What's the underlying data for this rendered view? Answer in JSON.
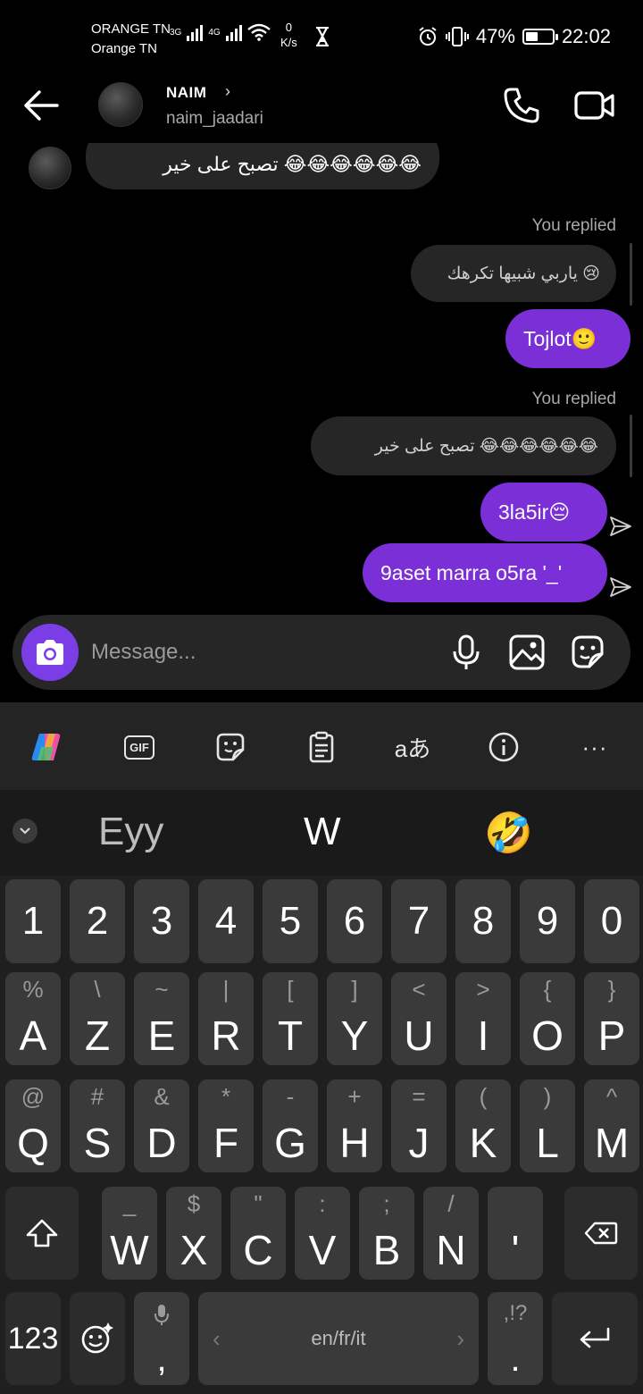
{
  "status_bar": {
    "carrier_line1": "ORANGE TN",
    "carrier_line2": "Orange TN",
    "network1": "3G",
    "network2": "4G",
    "speed_value": "0",
    "speed_unit": "K/s",
    "battery": "47%",
    "battery_level": 0.47,
    "time": "22:02"
  },
  "header": {
    "name": "NAIM",
    "username": "naim_jaadari"
  },
  "messages": {
    "incoming_1": "تصبح على خير 😂😂😂😂😂😂",
    "replied_label_1": "You replied",
    "quoted_1": "ياربي شبيها تكرهك 😢",
    "reply_1": "Tojlot🙂",
    "replied_label_2": "You replied",
    "quoted_2": "تصبح على خير 😂😂😂😂😂😂",
    "out_1": "3la5ir😔",
    "out_2": "9aset marra o5ra '_'"
  },
  "composer": {
    "placeholder": "Message..."
  },
  "keyboard": {
    "toolbar": [
      "copilot-icon",
      "gif-icon",
      "sticker-icon",
      "clipboard-icon",
      "translate-icon",
      "info-icon",
      "more-icon"
    ],
    "gif_label": "GIF",
    "translate_label": "aあ",
    "more_label": "···",
    "suggestions": [
      "Eyy",
      "W",
      "🤣"
    ],
    "row_numbers": [
      "1",
      "2",
      "3",
      "4",
      "5",
      "6",
      "7",
      "8",
      "9",
      "0"
    ],
    "row1": [
      {
        "main": "A",
        "alt": "%"
      },
      {
        "main": "Z",
        "alt": "\\"
      },
      {
        "main": "E",
        "alt": "~"
      },
      {
        "main": "R",
        "alt": "|"
      },
      {
        "main": "T",
        "alt": "["
      },
      {
        "main": "Y",
        "alt": "]"
      },
      {
        "main": "U",
        "alt": "<"
      },
      {
        "main": "I",
        "alt": ">"
      },
      {
        "main": "O",
        "alt": "{"
      },
      {
        "main": "P",
        "alt": "}"
      }
    ],
    "row2": [
      {
        "main": "Q",
        "alt": "@"
      },
      {
        "main": "S",
        "alt": "#"
      },
      {
        "main": "D",
        "alt": "&"
      },
      {
        "main": "F",
        "alt": "*"
      },
      {
        "main": "G",
        "alt": "-"
      },
      {
        "main": "H",
        "alt": "+"
      },
      {
        "main": "J",
        "alt": "="
      },
      {
        "main": "K",
        "alt": "("
      },
      {
        "main": "L",
        "alt": ")"
      },
      {
        "main": "M",
        "alt": "^"
      }
    ],
    "row3": [
      {
        "main": "W",
        "alt": "_"
      },
      {
        "main": "X",
        "alt": "$"
      },
      {
        "main": "C",
        "alt": "\""
      },
      {
        "main": "V",
        "alt": ":"
      },
      {
        "main": "B",
        "alt": ";"
      },
      {
        "main": "N",
        "alt": "/"
      },
      {
        "main": "'",
        "alt": ""
      }
    ],
    "numbers_key": "123",
    "comma_key": ",",
    "space_label": "en/fr/it",
    "period_key": ".",
    "period_alt": ",!?"
  },
  "colors": {
    "accent": "#7b2fd6",
    "camera": "#7b3ee6"
  }
}
